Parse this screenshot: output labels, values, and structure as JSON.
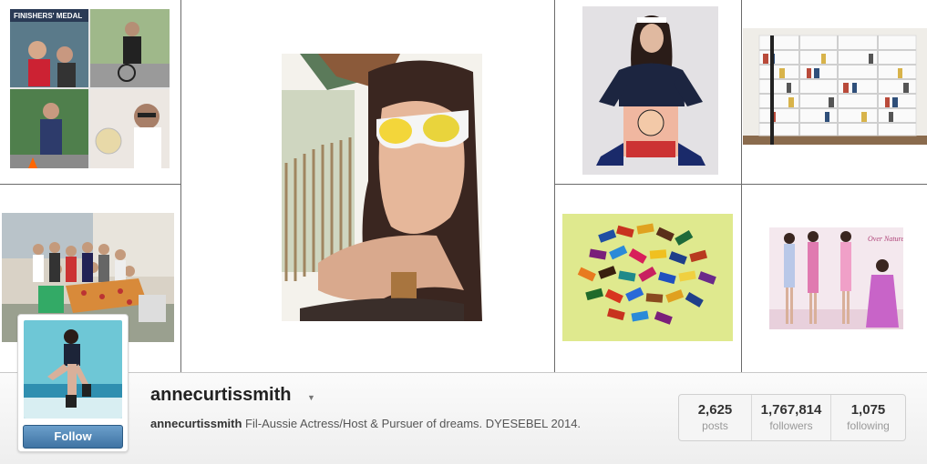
{
  "profile": {
    "username": "annecurtissmith",
    "bio_name": "annecurtissmith",
    "bio_text": "Fil-Aussie Actress/Host & Pursuer of dreams. DYESEBEL 2014.",
    "follow_label": "Follow"
  },
  "stats": [
    {
      "value": "2,625",
      "label": "posts"
    },
    {
      "value": "1,767,814",
      "label": "followers"
    },
    {
      "value": "1,075",
      "label": "following"
    }
  ],
  "photos": {
    "finishers_medal_text": "FINISHERS' MEDAL",
    "poster_text": "Over Nature"
  },
  "colors": {
    "follow_button": "#4a7fb0",
    "grid_lines": "#6b6b6b"
  }
}
